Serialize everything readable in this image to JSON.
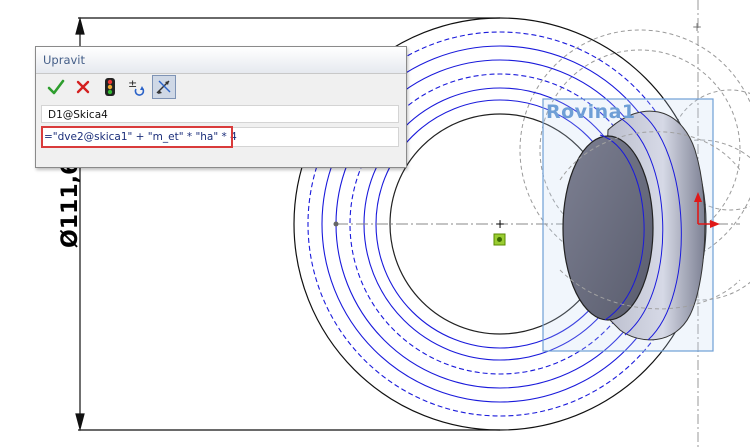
{
  "drawing": {
    "dimension_text": "Ø111,66",
    "plane_label": "Rovina1"
  },
  "dialog": {
    "title": "Upravit",
    "toolbar": {
      "ok": {
        "icon": "checkmark-icon",
        "color": "#2e9e2e"
      },
      "cancel": {
        "icon": "cross-icon",
        "color": "#d42020"
      },
      "rebuild": {
        "icon": "traffic-light-icon"
      },
      "spin": {
        "icon": "plus-minus-icon"
      },
      "mark": {
        "icon": "dimension-mark-icon"
      }
    },
    "dimension_name": "D1@Skica4",
    "equation": "=\"dve2@skica1\" + \"m_et\" * \"ha\" * 4"
  },
  "colors": {
    "sketch_blue": "#1a1adb",
    "plane_blue": "#6f9fd6",
    "highlight_red": "#d93b3b",
    "origin_red": "#e01818"
  }
}
